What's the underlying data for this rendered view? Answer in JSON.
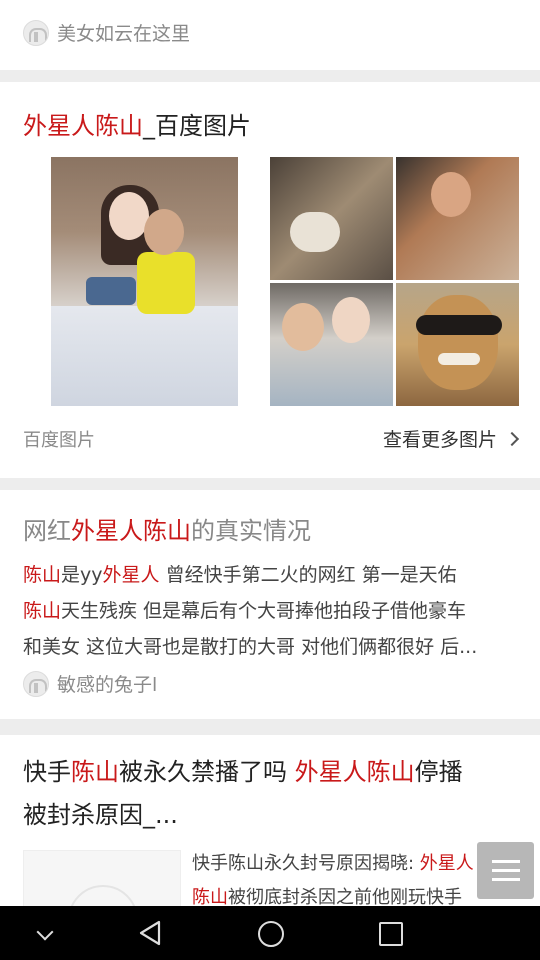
{
  "card1": {
    "source": "美女如云在这里"
  },
  "card2": {
    "title_hl": "外星人陈山",
    "title_rest": "_百度图片",
    "source": "百度图片",
    "more_label": "查看更多图片"
  },
  "card3": {
    "title_pre": "网红",
    "title_hl": "外星人陈山",
    "title_post": "的真实情况",
    "l1_a": "陈山",
    "l1_b": "是yy",
    "l1_c": "外星人",
    "l1_d": " 曾经快手第二火的网红 第一是天佑",
    "l2_a": "陈山",
    "l2_b": "天生残疾 但是幕后有个大哥捧他拍段子借他豪车",
    "l3": "和美女 这位大哥也是散打的大哥 对他们俩都很好 后...",
    "source": "敏感的兔子l"
  },
  "card4": {
    "t_a": "快手",
    "t_b": "陈山",
    "t_c": "被永久禁播了吗 ",
    "t_d": "外星人陈山",
    "t_e": "停播",
    "t_line2": "被封杀原因_...",
    "s1_a": "快手陈山永久封号原因揭晓: ",
    "s1_b": "外星人",
    "s2_a": "陈山",
    "s2_b": "被彻底封杀因之前他刚玩快手"
  },
  "icons": [
    "avatar-icon",
    "chevron-right-icon",
    "menu-lines-icon",
    "nav-hide-icon",
    "nav-back-icon",
    "nav-home-icon",
    "nav-recent-icon"
  ],
  "colors": {
    "highlight": "#c9191a",
    "muted": "#8a8a8a",
    "separator": "#ededed"
  }
}
